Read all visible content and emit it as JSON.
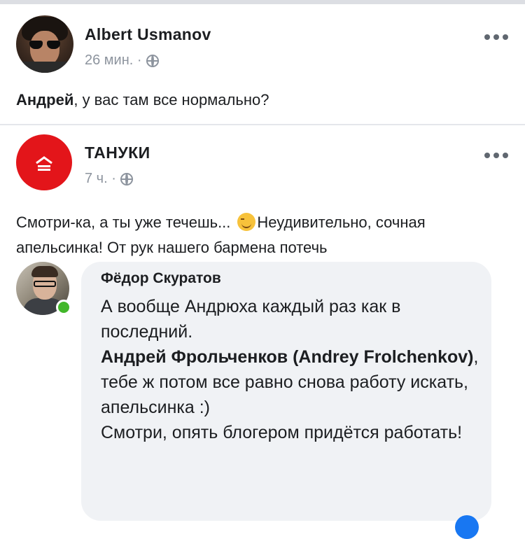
{
  "post1": {
    "author": "Albert Usmanov",
    "time": "26 мин. ·",
    "mention": "Андрей",
    "text": ", у вас там все нормально?"
  },
  "post2": {
    "author": "ТАНУКИ",
    "time": "7 ч. ·",
    "text_part1": "Смотри-ка, а ты уже течешь...",
    "text_part2": "Неудивительно, сочная апельсинка! От рук нашего бармена потечь"
  },
  "comment": {
    "author": "Фёдор Скуратов",
    "line1": "А вообще Андрюха каждый раз как в последний.",
    "mention": "Андрей Фрольченков (Andrey Frolchenkov)",
    "line2": ", тебе ж потом все равно снова работу искать, апельсинка :)",
    "line3": "Смотри, опять блогером придётся работать!"
  },
  "icons": {
    "privacy": "globe-icon",
    "more": "more-options-icon",
    "brand": "tanuki-logo",
    "online": "online-indicator"
  },
  "colors": {
    "brand_red": "#e3151a",
    "online_green": "#42b72a",
    "meta_gray": "#8d949e",
    "bubble_bg": "#f0f2f5"
  }
}
